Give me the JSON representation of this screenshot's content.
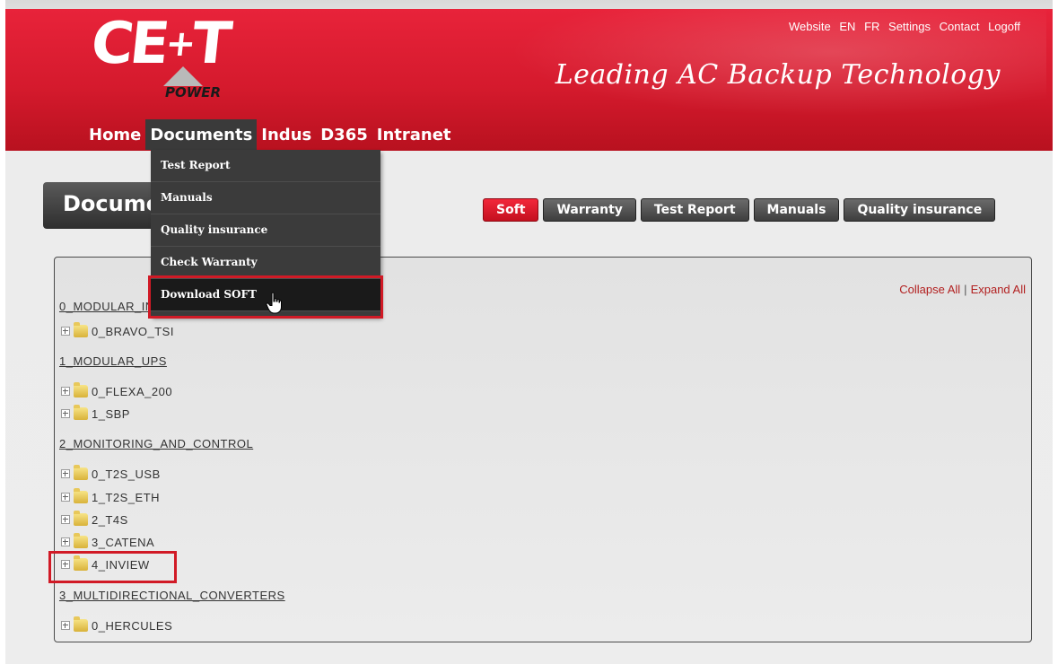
{
  "header": {
    "logo_text": "CE+T",
    "logo_sub": "POWER",
    "top_links": [
      "Website",
      "EN",
      "FR",
      "Settings",
      "Contact",
      "Logoff"
    ],
    "tagline": "Leading AC Backup Technology"
  },
  "nav": {
    "items": [
      "Home",
      "Documents",
      "Indus",
      "D365",
      "Intranet"
    ],
    "active": "Documents"
  },
  "dropdown": {
    "items": [
      "Test Report",
      "Manuals",
      "Quality insurance",
      "Check Warranty",
      "Download SOFT"
    ],
    "highlighted": "Download SOFT"
  },
  "page_title": "Documents",
  "tabs": [
    {
      "label": "Soft",
      "active": true
    },
    {
      "label": "Warranty",
      "active": false
    },
    {
      "label": "Test Report",
      "active": false
    },
    {
      "label": "Manuals",
      "active": false
    },
    {
      "label": "Quality insurance",
      "active": false
    }
  ],
  "tree_controls": {
    "collapse": "Collapse All",
    "separator": "|",
    "expand": "Expand All"
  },
  "tree": {
    "cat0": "0_MODULAR_INVERTER",
    "cat0_items": [
      "0_BRAVO_TSI"
    ],
    "cat1": "1_MODULAR_UPS",
    "cat1_items": [
      "0_FLEXA_200",
      "1_SBP"
    ],
    "cat2": "2_MONITORING_AND_CONTROL",
    "cat2_items": [
      "0_T2S_USB",
      "1_T2S_ETH",
      "2_T4S",
      "3_CATENA",
      "4_INVIEW"
    ],
    "cat3": "3_MULTIDIRECTIONAL_CONVERTERS",
    "cat3_items": [
      "0_HERCULES"
    ]
  },
  "colors": {
    "brand_red": "#d51a2d",
    "highlight_box": "#d11a26",
    "nav_dark": "#3b3b3b"
  }
}
